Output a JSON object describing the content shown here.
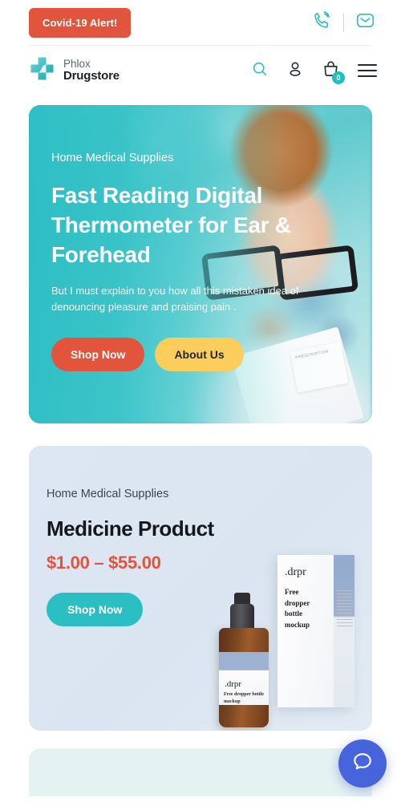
{
  "topbar": {
    "alert_label": "Covid-19 Alert!",
    "phone_icon": "phone-call-icon",
    "email_icon": "envelope-icon"
  },
  "header": {
    "brand_line1": "Phlox",
    "brand_line2": "Drugstore",
    "logo_icon": "medical-cross-logo",
    "search_icon": "search-icon",
    "account_icon": "user-account-icon",
    "bag_icon": "shopping-bag-icon",
    "cart_count": "0",
    "menu_icon": "hamburger-menu-icon"
  },
  "hero": {
    "kicker": "Home Medical Supplies",
    "heading": "Fast Reading Digital Thermometer for Ear & Forehead",
    "paragraph": "But I must explain to you how all this mistaken idea of denouncing pleasure and praising pain .",
    "primary_button": "Shop Now",
    "secondary_button": "About Us",
    "note_text": "PRESCRIPTION"
  },
  "product": {
    "kicker": "Home Medical Supplies",
    "title": "Medicine Product",
    "price": "$1.00 – $55.00",
    "button": "Shop Now",
    "box_brand": ".drpr",
    "box_text": "Free dropper bottle mockup",
    "bottle_brand": ".drpr",
    "bottle_text": "Free dropper bottle mockup"
  },
  "chat": {
    "icon": "chat-bubble-icon"
  },
  "colors": {
    "teal": "#2BBFC4",
    "hero_teal": "#3CC3C8",
    "red": "#E2543B",
    "yellow": "#FBCE5B",
    "chat_blue": "#4864DC",
    "card_blue": "#DDE7F2",
    "peek_mint": "#E4F2F1"
  }
}
